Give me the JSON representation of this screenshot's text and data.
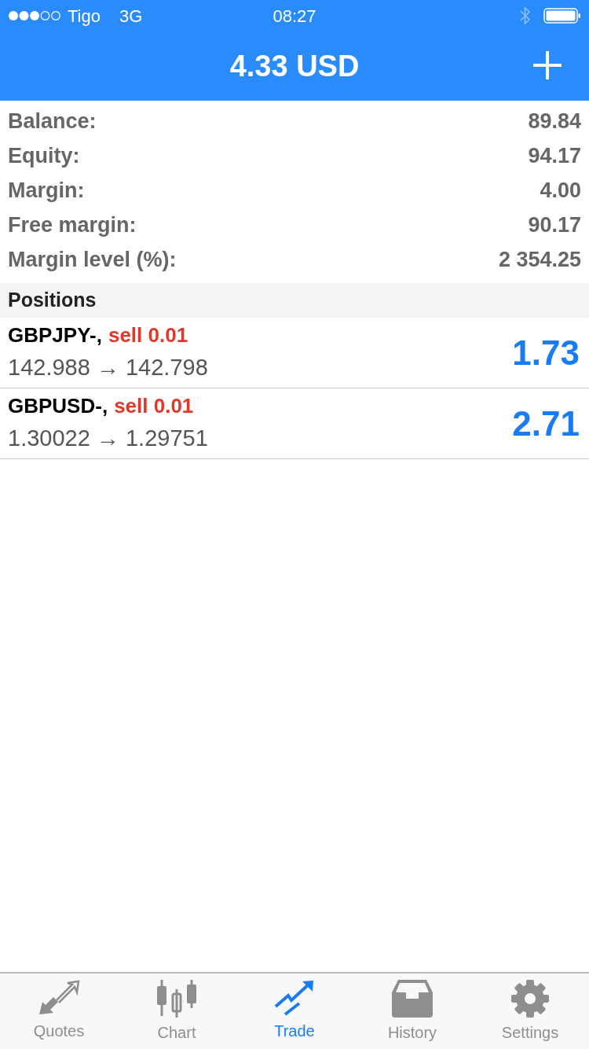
{
  "status_bar": {
    "carrier": "Tigo",
    "network": "3G",
    "time": "08:27"
  },
  "header": {
    "title": "4.33 USD"
  },
  "summary": [
    {
      "label": "Balance:",
      "value": "89.84"
    },
    {
      "label": "Equity:",
      "value": "94.17"
    },
    {
      "label": "Margin:",
      "value": "4.00"
    },
    {
      "label": "Free margin:",
      "value": "90.17"
    },
    {
      "label": "Margin level (%):",
      "value": "2 354.25"
    }
  ],
  "positions_header": "Positions",
  "positions": [
    {
      "symbol": "GBPJPY-,",
      "trade": "sell 0.01",
      "prices": "142.988 → 142.798",
      "profit": "1.73"
    },
    {
      "symbol": "GBPUSD-,",
      "trade": "sell 0.01",
      "prices": "1.30022 → 1.29751",
      "profit": "2.71"
    }
  ],
  "tabs": [
    {
      "kind": "quotes",
      "label": "Quotes",
      "selected": false
    },
    {
      "kind": "chart",
      "label": "Chart",
      "selected": false
    },
    {
      "kind": "trade",
      "label": "Trade",
      "selected": true
    },
    {
      "kind": "history",
      "label": "History",
      "selected": false
    },
    {
      "kind": "settings",
      "label": "Settings",
      "selected": false
    }
  ]
}
